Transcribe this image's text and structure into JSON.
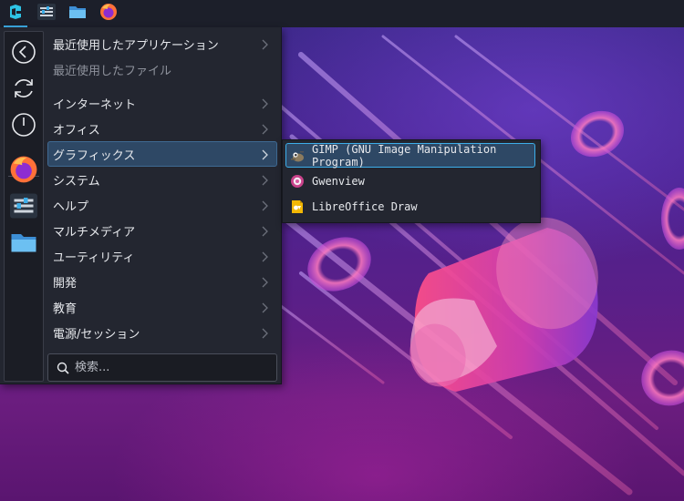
{
  "taskbar": {
    "launchers": [
      {
        "name": "application-launcher",
        "icon": "kde-launcher-icon"
      },
      {
        "name": "system-settings",
        "icon": "settings-sliders-icon"
      },
      {
        "name": "file-manager",
        "icon": "folder-icon"
      },
      {
        "name": "firefox",
        "icon": "firefox-icon"
      }
    ]
  },
  "favorites": [
    {
      "icon": "back-arrow-icon"
    },
    {
      "icon": "refresh-icon"
    },
    {
      "icon": "power-icon"
    },
    {
      "icon": "firefox-icon"
    },
    {
      "icon": "settings-sliders-icon"
    },
    {
      "icon": "folder-icon"
    }
  ],
  "categories": {
    "recent_apps": "最近使用したアプリケーション",
    "recent_files": "最近使用したファイル",
    "internet": "インターネット",
    "office": "オフィス",
    "graphics": "グラフィックス",
    "system": "システム",
    "help": "ヘルプ",
    "multimedia": "マルチメディア",
    "utilities": "ユーティリティ",
    "development": "開発",
    "education": "教育",
    "power_session": "電源/セッション"
  },
  "search": {
    "placeholder": "検索..."
  },
  "graphics_submenu": [
    {
      "label": "GIMP (GNU Image Manipulation Program)",
      "icon": "gimp-icon"
    },
    {
      "label": "Gwenview",
      "icon": "gwenview-icon"
    },
    {
      "label": "LibreOffice Draw",
      "icon": "libreoffice-draw-icon"
    }
  ],
  "colors": {
    "accent": "#3daee9",
    "selection": "#2e4865",
    "menu_bg": "#232630"
  }
}
